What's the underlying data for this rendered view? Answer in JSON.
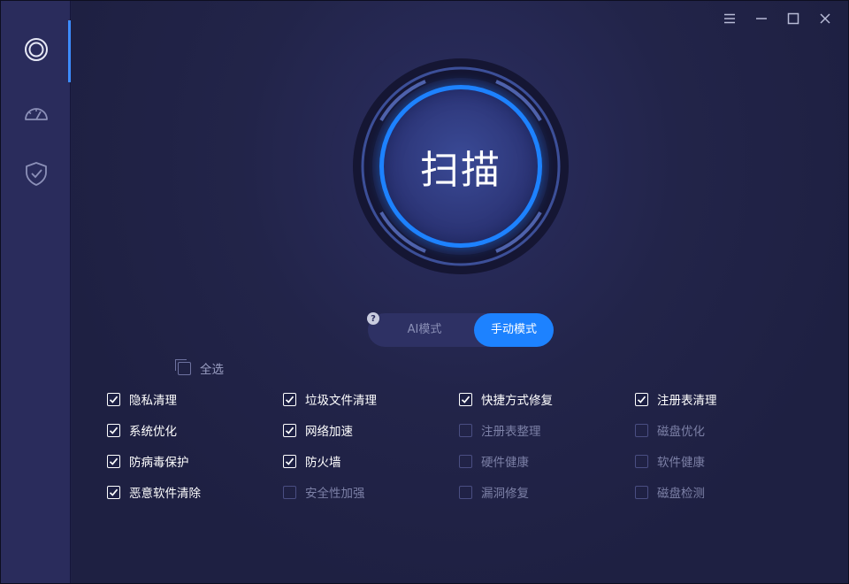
{
  "window": {
    "controls": [
      "menu-icon",
      "minimize-icon",
      "maximize-icon",
      "close-icon"
    ]
  },
  "sidebar": {
    "items": [
      {
        "name": "scan",
        "icon": "ring-icon",
        "active": true
      },
      {
        "name": "speed",
        "icon": "speedometer-icon",
        "active": false
      },
      {
        "name": "protect",
        "icon": "shield-check-icon",
        "active": false
      }
    ]
  },
  "scan": {
    "label": "扫描"
  },
  "mode": {
    "help": "?",
    "ai_label": "AI模式",
    "manual_label": "手动模式",
    "selected": "manual"
  },
  "options": {
    "select_all": {
      "label": "全选",
      "checked": false
    },
    "rows": [
      [
        {
          "label": "隐私清理",
          "checked": true
        },
        {
          "label": "垃圾文件清理",
          "checked": true
        },
        {
          "label": "快捷方式修复",
          "checked": true
        },
        {
          "label": "注册表清理",
          "checked": true
        }
      ],
      [
        {
          "label": "系统优化",
          "checked": true
        },
        {
          "label": "网络加速",
          "checked": true
        },
        {
          "label": "注册表整理",
          "checked": false
        },
        {
          "label": "磁盘优化",
          "checked": false
        }
      ],
      [
        {
          "label": "防病毒保护",
          "checked": true
        },
        {
          "label": "防火墙",
          "checked": true
        },
        {
          "label": "硬件健康",
          "checked": false
        },
        {
          "label": "软件健康",
          "checked": false
        }
      ],
      [
        {
          "label": "恶意软件清除",
          "checked": true
        },
        {
          "label": "安全性加强",
          "checked": false
        },
        {
          "label": "漏洞修复",
          "checked": false
        },
        {
          "label": "磁盘检测",
          "checked": false
        }
      ]
    ]
  },
  "colors": {
    "accent": "#1d82ff",
    "sidebar_bg": "#2a2c5c",
    "main_bg": "#1e2042",
    "text_on": "#ffffff",
    "text_off": "#7c80a6"
  }
}
